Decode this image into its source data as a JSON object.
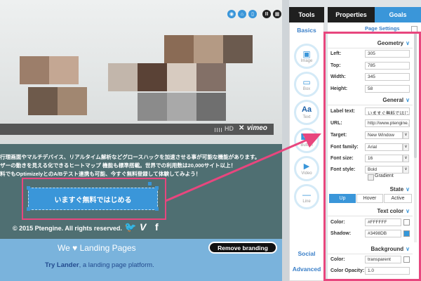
{
  "canvas": {
    "hero_text_lines": [
      "行理画面やマルチデバイス、リアルタイム解析などグロースハックを加速させる事が可能な機能があります。",
      "ザーの動きを見える化できるヒートマップ 機能も標準搭載。世界での利用数は20,000サイト以上！",
      "料でもOptimizelyとのA/Bテスト連携も可能、今すぐ無料登録して体験してみよう！"
    ],
    "video": {
      "hd": "HD",
      "close": "✕",
      "brand": "vimeo"
    },
    "cta_button": "いますぐ無料ではじめる",
    "copyright": "© 2015 Ptengine. All rights reserved.",
    "social_icons": {
      "twitter": "twitter-icon",
      "vimeo": "vimeo-icon",
      "facebook": "facebook-icon"
    },
    "social_glyphs": {
      "twitter": "🐦",
      "vimeo": "V",
      "facebook": "f"
    },
    "footer_tagline": "We ♥ Landing Pages",
    "remove_branding": "Remove branding",
    "try_lander_link": "Try Lander",
    "try_lander_rest": ", a landing page platform."
  },
  "tools": {
    "header": "Tools",
    "section_basics": "Basics",
    "items": [
      {
        "label": "Image",
        "glyph": "▣"
      },
      {
        "label": "Box",
        "glyph": "▭"
      },
      {
        "label": "Text",
        "glyph": "Aa"
      },
      {
        "label": "Button",
        "glyph": "Ok"
      },
      {
        "label": "Video",
        "glyph": "▶"
      },
      {
        "label": "Line",
        "glyph": "—"
      }
    ],
    "section_social": "Social",
    "section_advanced": "Advanced"
  },
  "properties": {
    "tabs": {
      "properties": "Properties",
      "goals": "Goals"
    },
    "page_settings": "Page Settings",
    "geometry": {
      "title": "Geometry",
      "left_label": "Left:",
      "left": "305",
      "top_label": "Top:",
      "top": "785",
      "width_label": "Width:",
      "width": "345",
      "height_label": "Height:",
      "height": "58"
    },
    "general": {
      "title": "General",
      "label_text_label": "Label text:",
      "label_text": "いますぐ無料ではじめ",
      "url_label": "URL:",
      "url": "http://www.ptengine.jp",
      "target_label": "Target:",
      "target": "New Window",
      "font_family_label": "Font family:",
      "font_family": "Arial",
      "font_size_label": "Font size:",
      "font_size": "16",
      "font_style_label": "Font style:",
      "font_style": "Bold",
      "gradient_label": "Gradient"
    },
    "state": {
      "title": "State",
      "up": "Up",
      "hover": "Hover",
      "active": "Active"
    },
    "text_color": {
      "title": "Text color",
      "color_label": "Color:",
      "color": "#FFFFFF",
      "shadow_label": "Shadow:",
      "shadow": "#3498DB"
    },
    "background": {
      "title": "Background",
      "color_label": "Color:",
      "color": "transparent",
      "opacity_label": "Color Opacity:",
      "opacity": "1.0"
    }
  },
  "colors": {
    "accent": "#3a96d9",
    "highlight": "#e8467e",
    "dark": "#1f1f1f"
  }
}
